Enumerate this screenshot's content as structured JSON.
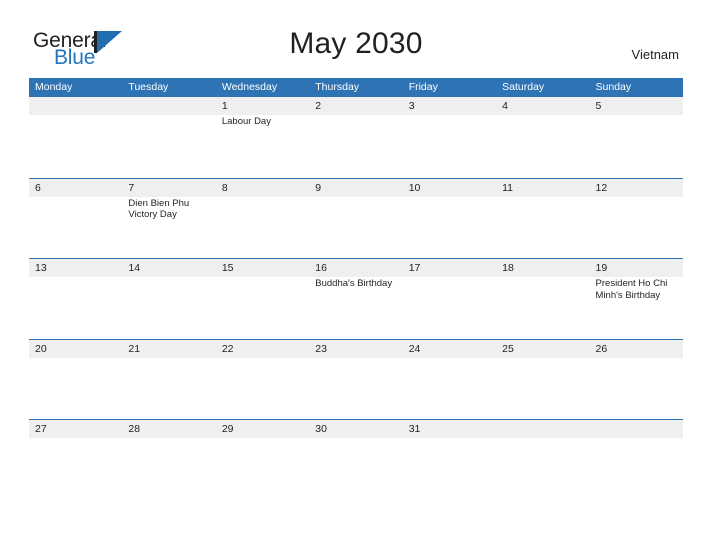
{
  "brand": {
    "name_part1": "General",
    "name_part2": "Blue",
    "logo_icon": "general-blue-triangle-logo"
  },
  "header": {
    "title": "May 2030",
    "country": "Vietnam"
  },
  "calendar": {
    "weekdays": [
      "Monday",
      "Tuesday",
      "Wednesday",
      "Thursday",
      "Friday",
      "Saturday",
      "Sunday"
    ],
    "colors": {
      "header_blue": "#2e74b5",
      "row_band_gray": "#efefef",
      "text": "#231f20",
      "logo_blue": "#2575bd"
    },
    "weeks": [
      {
        "days": [
          {
            "number": "",
            "event": ""
          },
          {
            "number": "",
            "event": ""
          },
          {
            "number": "1",
            "event": "Labour Day"
          },
          {
            "number": "2",
            "event": ""
          },
          {
            "number": "3",
            "event": ""
          },
          {
            "number": "4",
            "event": ""
          },
          {
            "number": "5",
            "event": ""
          }
        ]
      },
      {
        "days": [
          {
            "number": "6",
            "event": ""
          },
          {
            "number": "7",
            "event": "Dien Bien Phu Victory Day"
          },
          {
            "number": "8",
            "event": ""
          },
          {
            "number": "9",
            "event": ""
          },
          {
            "number": "10",
            "event": ""
          },
          {
            "number": "11",
            "event": ""
          },
          {
            "number": "12",
            "event": ""
          }
        ]
      },
      {
        "days": [
          {
            "number": "13",
            "event": ""
          },
          {
            "number": "14",
            "event": ""
          },
          {
            "number": "15",
            "event": ""
          },
          {
            "number": "16",
            "event": "Buddha's Birthday"
          },
          {
            "number": "17",
            "event": ""
          },
          {
            "number": "18",
            "event": ""
          },
          {
            "number": "19",
            "event": "President Ho Chi Minh's Birthday"
          }
        ]
      },
      {
        "days": [
          {
            "number": "20",
            "event": ""
          },
          {
            "number": "21",
            "event": ""
          },
          {
            "number": "22",
            "event": ""
          },
          {
            "number": "23",
            "event": ""
          },
          {
            "number": "24",
            "event": ""
          },
          {
            "number": "25",
            "event": ""
          },
          {
            "number": "26",
            "event": ""
          }
        ]
      },
      {
        "days": [
          {
            "number": "27",
            "event": ""
          },
          {
            "number": "28",
            "event": ""
          },
          {
            "number": "29",
            "event": ""
          },
          {
            "number": "30",
            "event": ""
          },
          {
            "number": "31",
            "event": ""
          },
          {
            "number": "",
            "event": ""
          },
          {
            "number": "",
            "event": ""
          }
        ]
      }
    ]
  }
}
